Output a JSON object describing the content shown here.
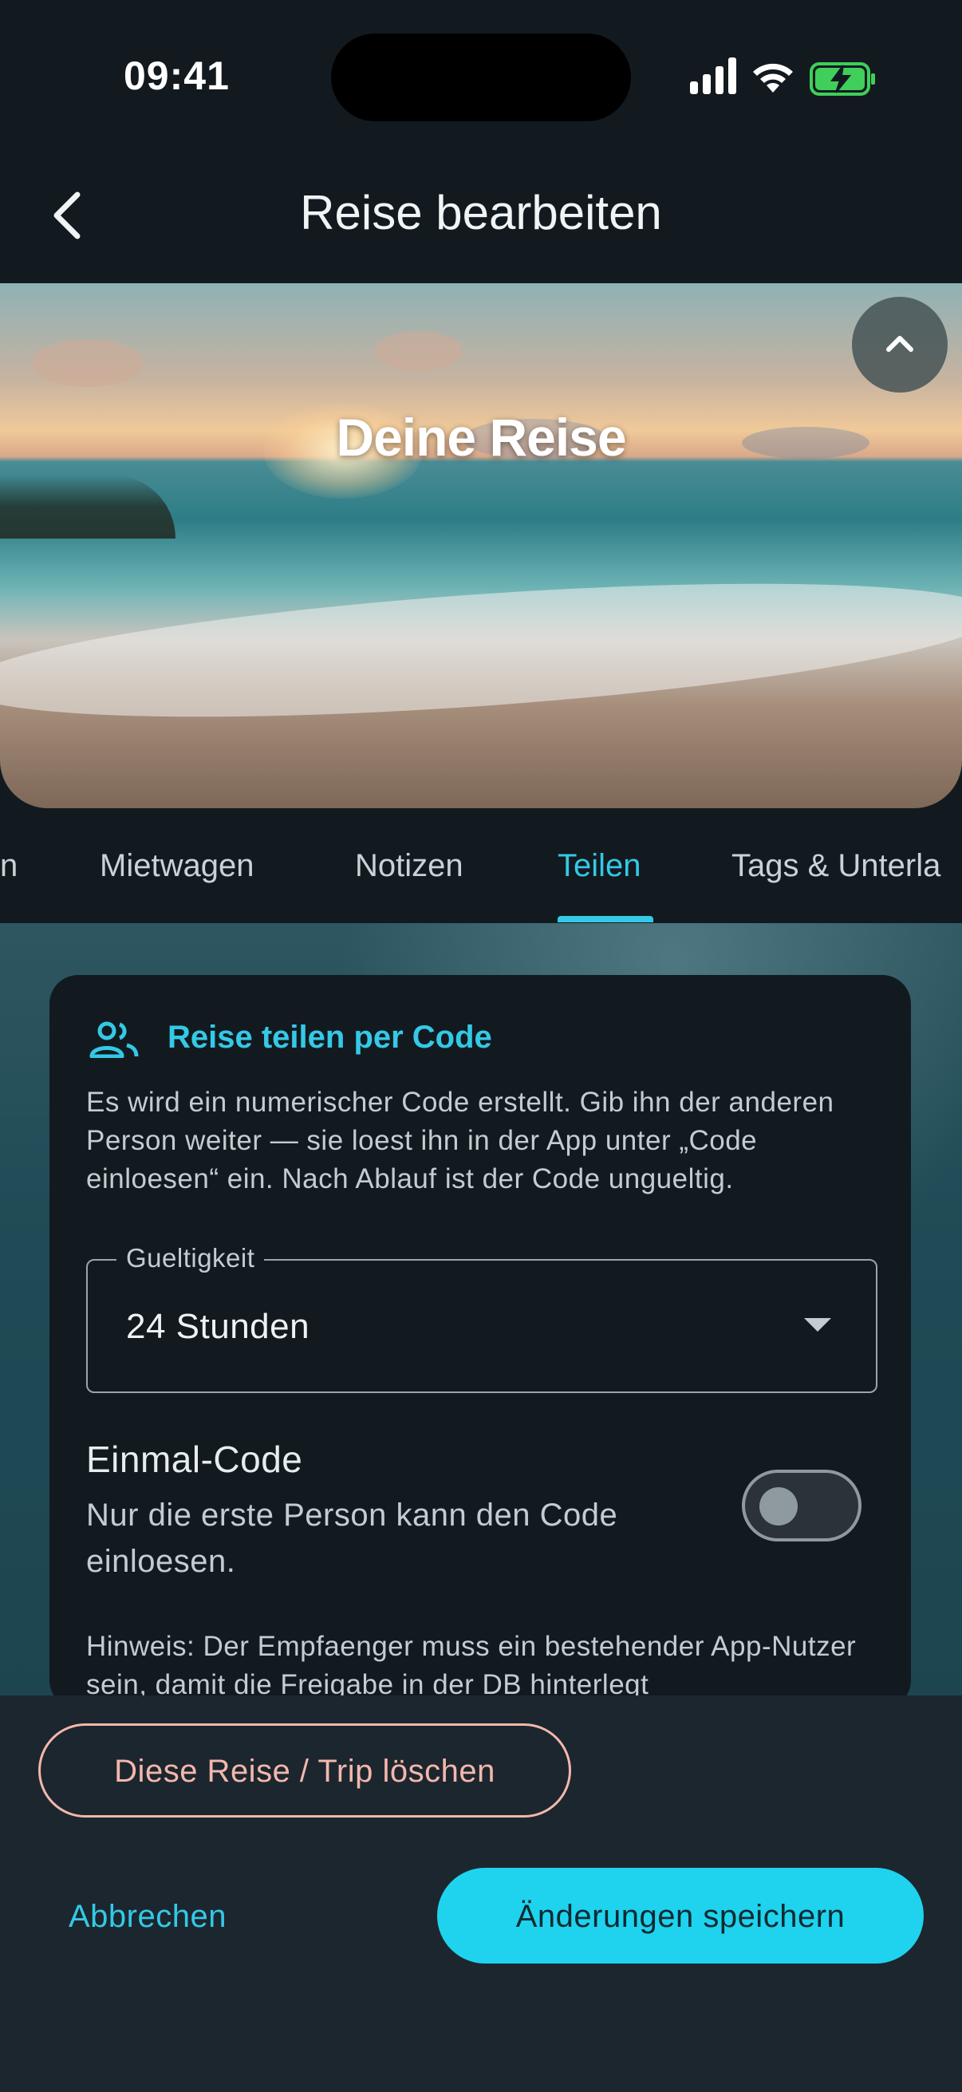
{
  "status_bar": {
    "time": "09:41"
  },
  "app_bar": {
    "title": "Reise bearbeiten"
  },
  "hero": {
    "title": "Deine Reise"
  },
  "tabs": [
    {
      "label": "n"
    },
    {
      "label": "Mietwagen"
    },
    {
      "label": "Notizen"
    },
    {
      "label": "Teilen",
      "active": true
    },
    {
      "label": "Tags & Unterla"
    }
  ],
  "share_card": {
    "heading": "Reise teilen per Code",
    "description": "Es wird ein numerischer Code erstellt. Gib ihn der anderen Person weiter — sie loest ihn in der App unter „Code einloesen“ ein. Nach Ablauf ist der Code ungueltig.",
    "validity": {
      "label": "Gueltigkeit",
      "value": "24 Stunden"
    },
    "one_time": {
      "title": "Einmal-Code",
      "description": "Nur die erste Person kann den Code einloesen.",
      "enabled": false
    },
    "hint": "Hinweis: Der Empfaenger muss ein bestehender App-Nutzer sein, damit die Freigabe in der DB hinterlegt"
  },
  "actions": {
    "delete_label": "Diese Reise / Trip löschen",
    "cancel_label": "Abbrechen",
    "save_label": "Änderungen speichern"
  },
  "colors": {
    "accent": "#34c9e6",
    "primary_button": "#1fd3ee",
    "danger": "#f3b7ad",
    "background": "#121a20"
  }
}
